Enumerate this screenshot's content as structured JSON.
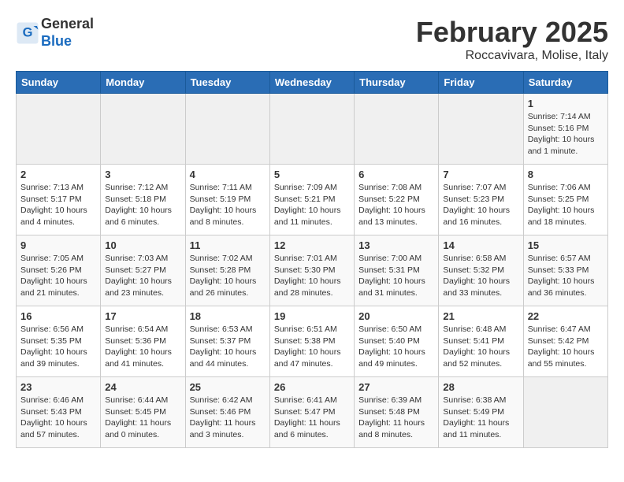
{
  "header": {
    "logo_general": "General",
    "logo_blue": "Blue",
    "month_title": "February 2025",
    "location": "Roccavivara, Molise, Italy"
  },
  "weekdays": [
    "Sunday",
    "Monday",
    "Tuesday",
    "Wednesday",
    "Thursday",
    "Friday",
    "Saturday"
  ],
  "weeks": [
    [
      {
        "day": "",
        "info": ""
      },
      {
        "day": "",
        "info": ""
      },
      {
        "day": "",
        "info": ""
      },
      {
        "day": "",
        "info": ""
      },
      {
        "day": "",
        "info": ""
      },
      {
        "day": "",
        "info": ""
      },
      {
        "day": "1",
        "info": "Sunrise: 7:14 AM\nSunset: 5:16 PM\nDaylight: 10 hours and 1 minute."
      }
    ],
    [
      {
        "day": "2",
        "info": "Sunrise: 7:13 AM\nSunset: 5:17 PM\nDaylight: 10 hours and 4 minutes."
      },
      {
        "day": "3",
        "info": "Sunrise: 7:12 AM\nSunset: 5:18 PM\nDaylight: 10 hours and 6 minutes."
      },
      {
        "day": "4",
        "info": "Sunrise: 7:11 AM\nSunset: 5:19 PM\nDaylight: 10 hours and 8 minutes."
      },
      {
        "day": "5",
        "info": "Sunrise: 7:09 AM\nSunset: 5:21 PM\nDaylight: 10 hours and 11 minutes."
      },
      {
        "day": "6",
        "info": "Sunrise: 7:08 AM\nSunset: 5:22 PM\nDaylight: 10 hours and 13 minutes."
      },
      {
        "day": "7",
        "info": "Sunrise: 7:07 AM\nSunset: 5:23 PM\nDaylight: 10 hours and 16 minutes."
      },
      {
        "day": "8",
        "info": "Sunrise: 7:06 AM\nSunset: 5:25 PM\nDaylight: 10 hours and 18 minutes."
      }
    ],
    [
      {
        "day": "9",
        "info": "Sunrise: 7:05 AM\nSunset: 5:26 PM\nDaylight: 10 hours and 21 minutes."
      },
      {
        "day": "10",
        "info": "Sunrise: 7:03 AM\nSunset: 5:27 PM\nDaylight: 10 hours and 23 minutes."
      },
      {
        "day": "11",
        "info": "Sunrise: 7:02 AM\nSunset: 5:28 PM\nDaylight: 10 hours and 26 minutes."
      },
      {
        "day": "12",
        "info": "Sunrise: 7:01 AM\nSunset: 5:30 PM\nDaylight: 10 hours and 28 minutes."
      },
      {
        "day": "13",
        "info": "Sunrise: 7:00 AM\nSunset: 5:31 PM\nDaylight: 10 hours and 31 minutes."
      },
      {
        "day": "14",
        "info": "Sunrise: 6:58 AM\nSunset: 5:32 PM\nDaylight: 10 hours and 33 minutes."
      },
      {
        "day": "15",
        "info": "Sunrise: 6:57 AM\nSunset: 5:33 PM\nDaylight: 10 hours and 36 minutes."
      }
    ],
    [
      {
        "day": "16",
        "info": "Sunrise: 6:56 AM\nSunset: 5:35 PM\nDaylight: 10 hours and 39 minutes."
      },
      {
        "day": "17",
        "info": "Sunrise: 6:54 AM\nSunset: 5:36 PM\nDaylight: 10 hours and 41 minutes."
      },
      {
        "day": "18",
        "info": "Sunrise: 6:53 AM\nSunset: 5:37 PM\nDaylight: 10 hours and 44 minutes."
      },
      {
        "day": "19",
        "info": "Sunrise: 6:51 AM\nSunset: 5:38 PM\nDaylight: 10 hours and 47 minutes."
      },
      {
        "day": "20",
        "info": "Sunrise: 6:50 AM\nSunset: 5:40 PM\nDaylight: 10 hours and 49 minutes."
      },
      {
        "day": "21",
        "info": "Sunrise: 6:48 AM\nSunset: 5:41 PM\nDaylight: 10 hours and 52 minutes."
      },
      {
        "day": "22",
        "info": "Sunrise: 6:47 AM\nSunset: 5:42 PM\nDaylight: 10 hours and 55 minutes."
      }
    ],
    [
      {
        "day": "23",
        "info": "Sunrise: 6:46 AM\nSunset: 5:43 PM\nDaylight: 10 hours and 57 minutes."
      },
      {
        "day": "24",
        "info": "Sunrise: 6:44 AM\nSunset: 5:45 PM\nDaylight: 11 hours and 0 minutes."
      },
      {
        "day": "25",
        "info": "Sunrise: 6:42 AM\nSunset: 5:46 PM\nDaylight: 11 hours and 3 minutes."
      },
      {
        "day": "26",
        "info": "Sunrise: 6:41 AM\nSunset: 5:47 PM\nDaylight: 11 hours and 6 minutes."
      },
      {
        "day": "27",
        "info": "Sunrise: 6:39 AM\nSunset: 5:48 PM\nDaylight: 11 hours and 8 minutes."
      },
      {
        "day": "28",
        "info": "Sunrise: 6:38 AM\nSunset: 5:49 PM\nDaylight: 11 hours and 11 minutes."
      },
      {
        "day": "",
        "info": ""
      }
    ]
  ]
}
